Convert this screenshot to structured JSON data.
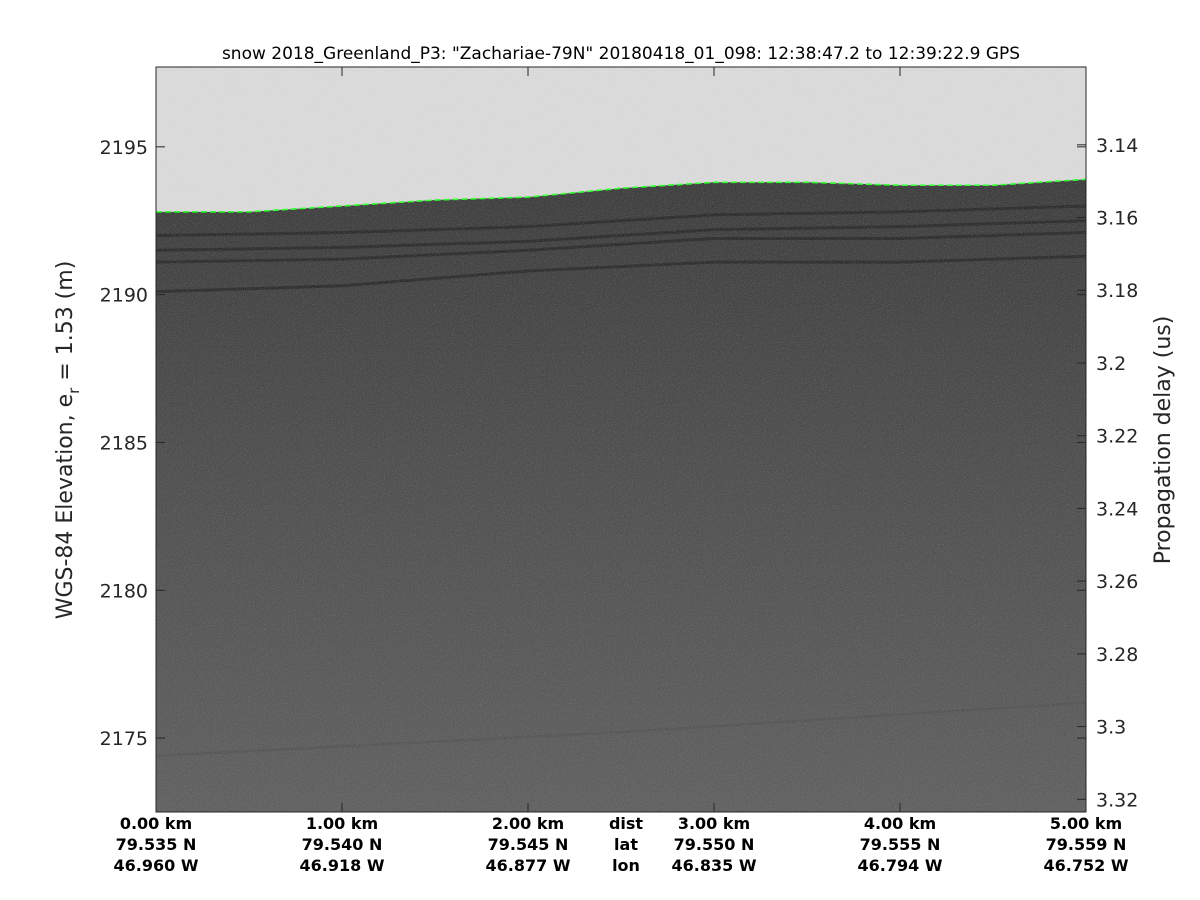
{
  "chart_data": {
    "type": "heatmap",
    "title": "snow 2018_Greenland_P3: \"Zachariae-79N\"  20180418_01_098: 12:38:47.2 to 12:39:22.9 GPS",
    "ylabel_main": "WGS-84 Elevation, e",
    "ylabel_sub": "r",
    "ylabel_tail": " = 1.53 (m)",
    "y2label": "Propagation delay (us)",
    "ylim": [
      2172.5,
      2197.7
    ],
    "yticks": [
      2175,
      2180,
      2185,
      2190,
      2195
    ],
    "y2lim": [
      3.3235,
      3.1186
    ],
    "y2ticks": [
      3.14,
      3.16,
      3.18,
      3.2,
      3.22,
      3.24,
      3.26,
      3.28,
      3.3,
      3.32
    ],
    "y2ticklabels": [
      "3.14",
      "3.16",
      "3.18",
      "3.2",
      "3.22",
      "3.24",
      "3.26",
      "3.28",
      "3.3",
      "3.32"
    ],
    "xlim": [
      0,
      5
    ],
    "xticks": [
      0,
      1,
      2,
      3,
      4,
      5
    ],
    "bottom_rows": [
      {
        "key": "dist",
        "labels": [
          "0.00 km",
          "1.00 km",
          "2.00 km",
          "3.00 km",
          "4.00 km",
          "5.00 km"
        ]
      },
      {
        "key": "lat",
        "labels": [
          "79.535 N",
          "79.540 N",
          "79.545 N",
          "79.550 N",
          "79.555 N",
          "79.559 N"
        ]
      },
      {
        "key": "lon",
        "labels": [
          "46.960 W",
          "46.918 W",
          "46.877 W",
          "46.835 W",
          "46.794 W",
          "46.752 W"
        ]
      }
    ],
    "surface_pick_color": "#33ff33",
    "surface_elevation": {
      "x": [
        0,
        0.5,
        1.0,
        1.5,
        2.0,
        2.5,
        3.0,
        3.5,
        4.0,
        4.5,
        5.0
      ],
      "y": [
        2192.8,
        2192.8,
        2193.0,
        2193.2,
        2193.3,
        2193.6,
        2193.8,
        2193.8,
        2193.7,
        2193.7,
        2193.9
      ]
    },
    "internal_layers": [
      {
        "x": [
          0,
          1,
          2,
          3,
          4,
          5
        ],
        "y": [
          2192.0,
          2192.1,
          2192.3,
          2192.7,
          2192.8,
          2193.0
        ]
      },
      {
        "x": [
          0,
          1,
          2,
          3,
          4,
          5
        ],
        "y": [
          2191.5,
          2191.6,
          2191.8,
          2192.2,
          2192.3,
          2192.5
        ]
      },
      {
        "x": [
          0,
          1,
          2,
          3,
          4,
          5
        ],
        "y": [
          2191.1,
          2191.2,
          2191.5,
          2191.9,
          2191.9,
          2192.1
        ]
      },
      {
        "x": [
          0,
          1,
          2,
          3,
          4,
          5
        ],
        "y": [
          2190.1,
          2190.3,
          2190.8,
          2191.1,
          2191.1,
          2191.3
        ]
      },
      {
        "x": [
          0,
          2.5,
          5
        ],
        "y": [
          2174.4,
          2175.2,
          2176.2
        ]
      }
    ]
  }
}
